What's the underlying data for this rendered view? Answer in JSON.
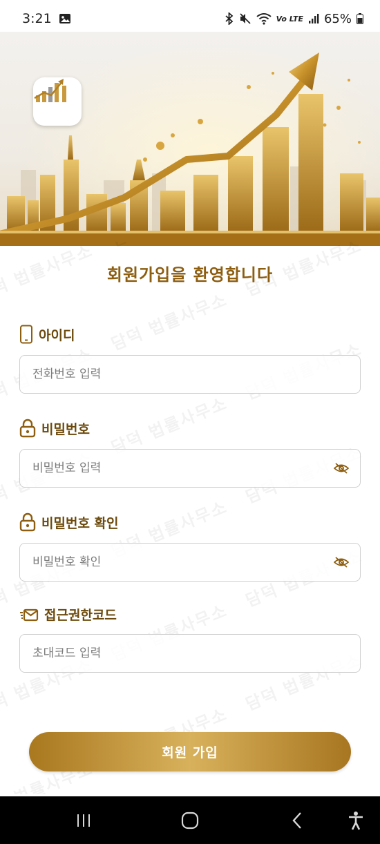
{
  "status_bar": {
    "time": "3:21",
    "network_label": "Vo LTE",
    "battery": "65%"
  },
  "hero": {
    "logo_icon": "rising-bar-chart-logo"
  },
  "watermark_text": "담덕 법률사무소",
  "page_title": "회원가입을 환영합니다",
  "fields": {
    "id": {
      "label": "아이디",
      "placeholder": "전화번호 입력",
      "value": "",
      "icon": "phone-icon"
    },
    "password": {
      "label": "비밀번호",
      "placeholder": "비밀번호 입력",
      "value": "",
      "icon": "lock-icon",
      "toggle_icon": "eye-slash-icon"
    },
    "password_confirm": {
      "label": "비밀번호 확인",
      "placeholder": "비밀번호 확인",
      "value": "",
      "icon": "lock-icon",
      "toggle_icon": "eye-slash-icon"
    },
    "access_code": {
      "label": "접근권한코드",
      "placeholder": "초대코드 입력",
      "value": "",
      "icon": "envelope-icon"
    }
  },
  "submit_label": "회원 가입",
  "nav": {
    "recent": "recent-apps-icon",
    "home": "home-icon",
    "back": "back-icon",
    "accessibility": "accessibility-icon"
  },
  "colors": {
    "accent_gold": "#8d5e10",
    "label_brown": "#6c4a0d",
    "button_gold": "#c49a45"
  }
}
